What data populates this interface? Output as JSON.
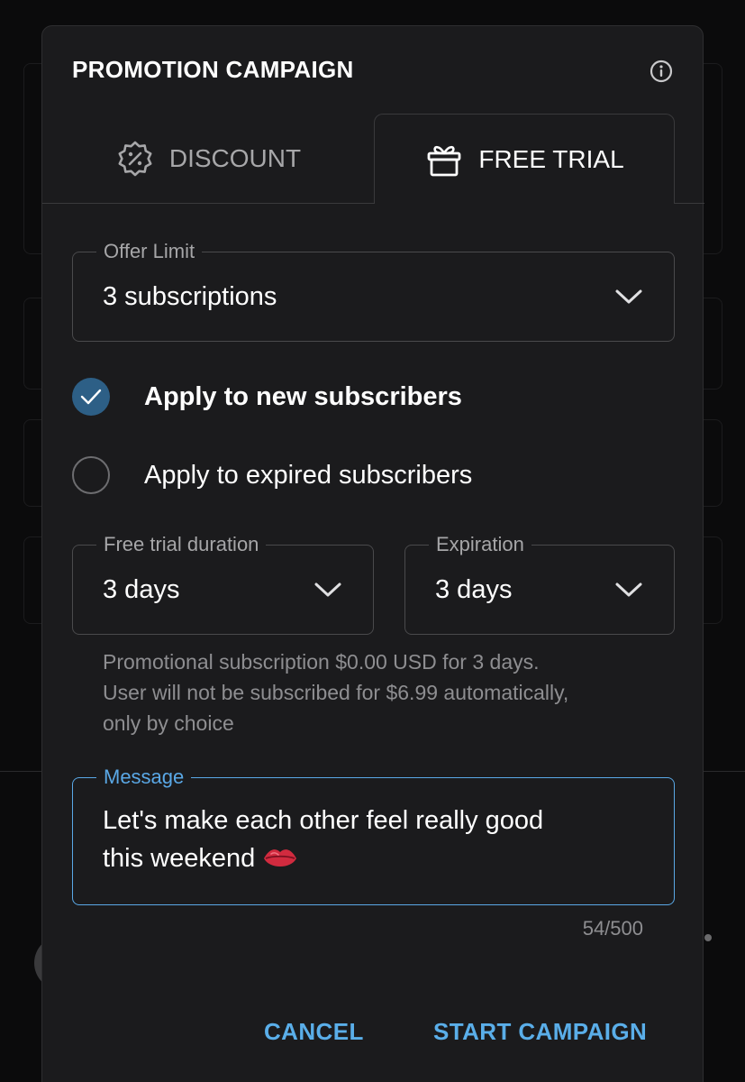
{
  "dialog": {
    "title": "PROMOTION CAMPAIGN",
    "info_icon": "info-icon"
  },
  "tabs": [
    {
      "label": "DISCOUNT",
      "icon": "discount-badge-icon",
      "selected": false
    },
    {
      "label": "FREE TRIAL",
      "icon": "gift-icon",
      "selected": true
    }
  ],
  "offer_limit": {
    "label": "Offer Limit",
    "value": "3 subscriptions"
  },
  "options": {
    "new_subscribers": {
      "label": "Apply to new subscribers",
      "checked": true
    },
    "expired_subscribers": {
      "label": "Apply to expired subscribers",
      "checked": false
    }
  },
  "trial_duration": {
    "label": "Free trial duration",
    "value": "3 days"
  },
  "expiration": {
    "label": "Expiration",
    "value": "3 days"
  },
  "helper": {
    "line1": "Promotional subscription $0.00 USD for 3 days.",
    "line2": "User will not be subscribed for $6.99 automatically,",
    "line3": "only by choice"
  },
  "message": {
    "label": "Message",
    "line1": "Let's make each other feel really good",
    "line2": "this weekend",
    "emoji_icon": "kiss-lips-icon",
    "counter": "54/500"
  },
  "actions": {
    "cancel": "CANCEL",
    "start": "START CAMPAIGN"
  },
  "colors": {
    "dialog_bg": "#1b1b1d",
    "accent": "#5aaee9",
    "checked_radio": "#2d5f86"
  }
}
